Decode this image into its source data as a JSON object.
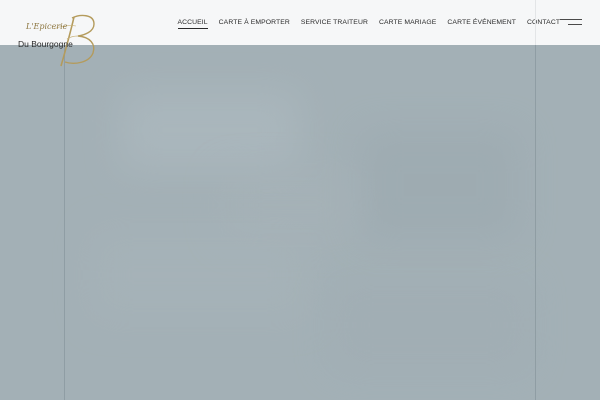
{
  "brand": {
    "line1": "L'Epicerie",
    "line2": "Du Bourgogne",
    "monogram": "B",
    "accent_color": "#b49b5c"
  },
  "nav": {
    "items": [
      {
        "label": "ACCUEIL",
        "active": true
      },
      {
        "label": "CARTE À EMPORTER",
        "active": false
      },
      {
        "label": "SERVICE TRAITEUR",
        "active": false
      },
      {
        "label": "CARTE MARIAGE",
        "active": false
      },
      {
        "label": "CARTE ÉVÉNEMENT",
        "active": false
      },
      {
        "label": "CONTACT",
        "active": false
      }
    ]
  },
  "menu_toggle": {
    "icon": "hamburger-icon"
  },
  "hero": {
    "background_color": "#a3b0b6"
  }
}
